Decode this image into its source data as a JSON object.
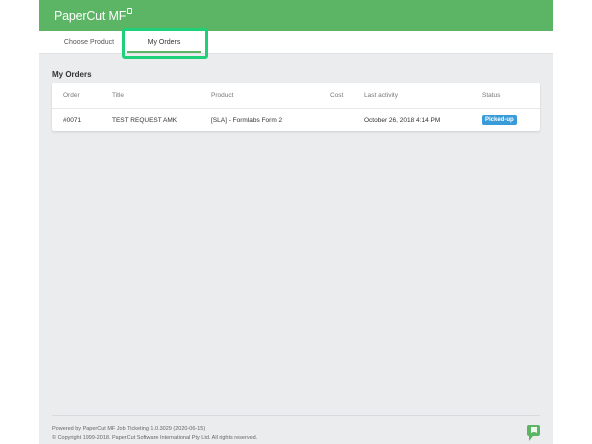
{
  "header": {
    "brand": "PaperCut",
    "brand_suffix": "MF"
  },
  "tabs": [
    {
      "label": "Choose Product",
      "active": false
    },
    {
      "label": "My Orders",
      "active": true
    }
  ],
  "section": {
    "title": "My Orders"
  },
  "table": {
    "columns": [
      "Order",
      "Title",
      "Product",
      "Cost",
      "Last activity",
      "Status"
    ],
    "rows": [
      {
        "order": "#0071",
        "title": "TEST REQUEST AMK",
        "product": "[SLA] - Formlabs Form 2",
        "cost": "",
        "last_activity": "October 26, 2018 4:14 PM",
        "status": "Picked-up"
      }
    ]
  },
  "footer": {
    "line1": "Powered by PaperCut MF Job Ticketing 1.0.3029 (2020-06-15)",
    "line2": "© Copyright 1999-2018. PaperCut Software International Pty Ltd. All rights reserved."
  },
  "colors": {
    "brand_green": "#5bb565",
    "highlight": "#1fd07a",
    "status_badge": "#3a9bd9",
    "background": "#ebecee"
  },
  "icons": [
    "papercut-logo-mark",
    "papercut-footer-icon"
  ]
}
